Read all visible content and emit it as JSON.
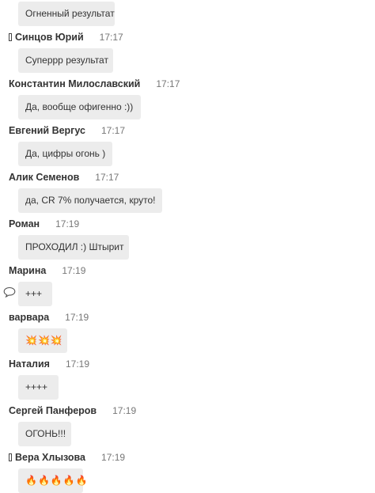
{
  "messages": [
    {
      "author": "",
      "time": "",
      "text": "Огненный результат"
    },
    {
      "author": "Синцов Юрий",
      "time": "17:17",
      "text": "Суперрр результат"
    },
    {
      "author": "Константин Милославский",
      "time": "17:17",
      "text": "Да, вообще офигенно :))"
    },
    {
      "author": "Евгений Вергус",
      "time": "17:17",
      "text": "Да, цифры огонь )"
    },
    {
      "author": "Алик Семенов",
      "time": "17:17",
      "text": "да, CR 7% получается, круто!"
    },
    {
      "author": "Роман",
      "time": "17:19",
      "text": "ПРОХОДИЛ :) Штырит"
    },
    {
      "author": "Марина",
      "time": "17:19",
      "text": "+++"
    },
    {
      "author": "варвара",
      "time": "17:19",
      "text": "💥💥💥"
    },
    {
      "author": "Наталия",
      "time": "17:19",
      "text": "++++"
    },
    {
      "author": "Сергей Панферов",
      "time": "17:19",
      "text": "ОГОНЬ!!!"
    },
    {
      "author": "Вера Хлызова",
      "time": "17:19",
      "text": "🔥🔥🔥🔥🔥"
    }
  ],
  "icons": {
    "reply": "speech-bubble-icon",
    "status": "status-icon",
    "burst": "collision-emoji",
    "fire": "fire-emoji"
  },
  "colors": {
    "bubble": "#ececec",
    "author": "#333333",
    "time": "#777777"
  }
}
